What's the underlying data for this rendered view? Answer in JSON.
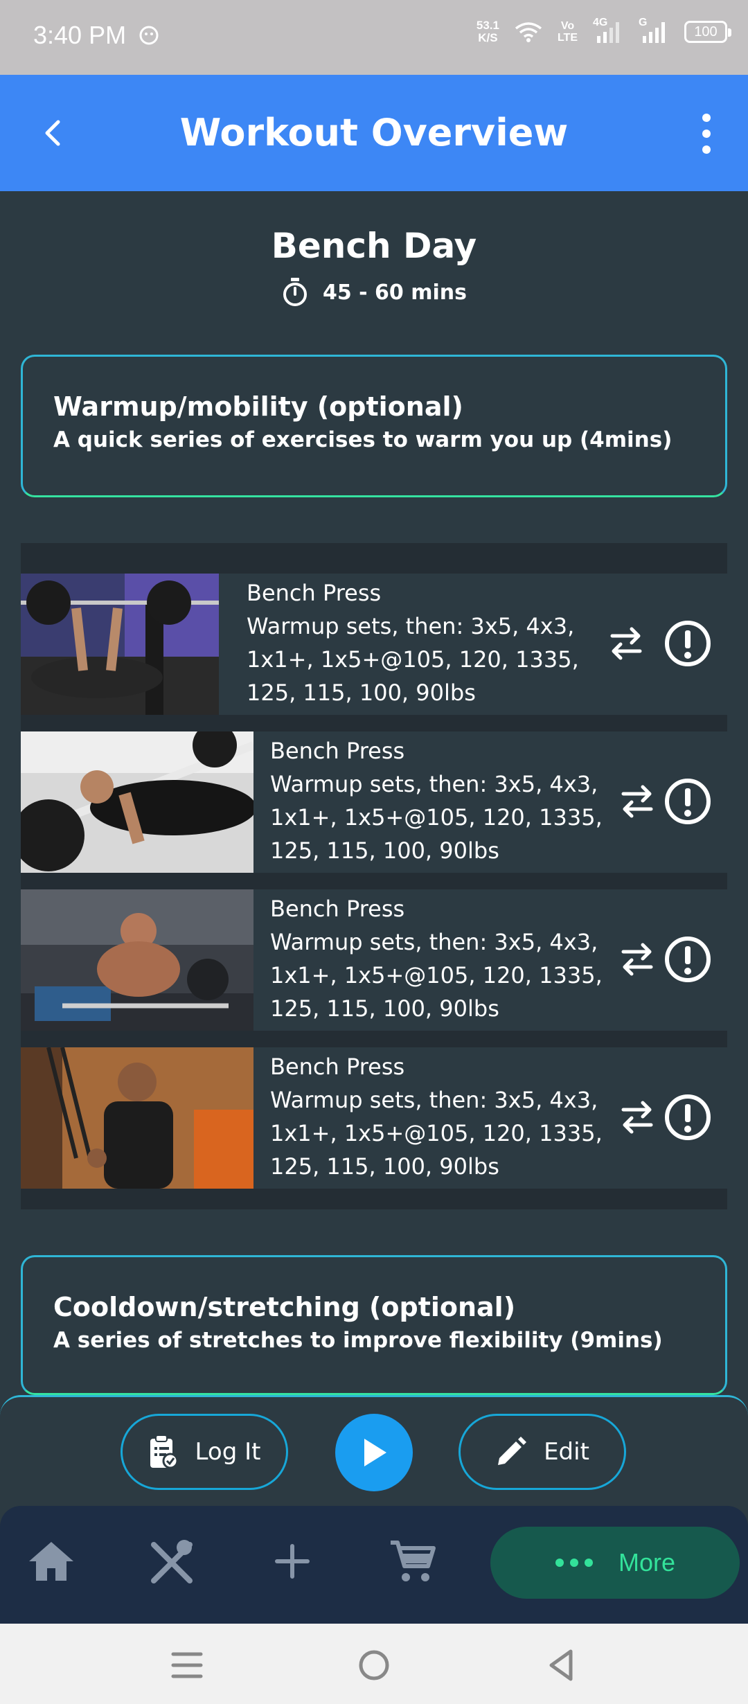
{
  "status_bar": {
    "time": "3:40 PM",
    "net_speed_value": "53.1",
    "net_speed_unit": "K/S",
    "volte_top": "Vo",
    "volte_bottom": "LTE",
    "network_label": "4G",
    "network_label_2": "G",
    "battery": "100"
  },
  "header": {
    "title": "Workout Overview",
    "back_icon": "chevron-left-icon",
    "menu_icon": "more-vertical-icon"
  },
  "workout": {
    "name": "Bench Day",
    "duration": "45 - 60 mins",
    "timer_icon": "stopwatch-icon"
  },
  "warmup": {
    "title": "Warmup/mobility (optional)",
    "description": "A quick series of exercises to warm you up (4mins)"
  },
  "exercises": [
    {
      "name": "Bench Press",
      "line1": "Warmup sets, then: 3x5, 4x3,",
      "line2": "1x1+, 1x5+@105, 120, 1335,",
      "line3": "125, 115, 100, 90lbs"
    },
    {
      "name": "Bench Press",
      "line1": "Warmup sets, then: 3x5, 4x3,",
      "line2": "1x1+, 1x5+@105, 120, 1335,",
      "line3": "125, 115, 100, 90lbs"
    },
    {
      "name": "Bench Press",
      "line1": "Warmup sets, then: 3x5, 4x3,",
      "line2": "1x1+, 1x5+@105, 120, 1335,",
      "line3": "125, 115, 100, 90lbs"
    },
    {
      "name": "Bench Press",
      "line1": "Warmup sets, then: 3x5, 4x3,",
      "line2": "1x1+, 1x5+@105, 120, 1335,",
      "line3": "125, 115, 100, 90lbs"
    }
  ],
  "cooldown": {
    "title": "Cooldown/stretching (optional)",
    "description": "A series of stretches to improve flexibility (9mins)"
  },
  "actions": {
    "log_label": "Log It",
    "edit_label": "Edit",
    "log_icon": "clipboard-check-icon",
    "play_icon": "play-icon",
    "edit_icon": "pencil-icon"
  },
  "bottom_nav": {
    "items": [
      "home-icon",
      "utensils-icon",
      "plus-icon",
      "cart-icon"
    ],
    "more_label": "More",
    "more_icon": "dots-horizontal-icon"
  },
  "colors": {
    "header": "#3d87f5",
    "background": "#2c3a42",
    "accent_cyan": "#17a7d8",
    "accent_green": "#33e29a",
    "nav": "#1d2d45"
  }
}
